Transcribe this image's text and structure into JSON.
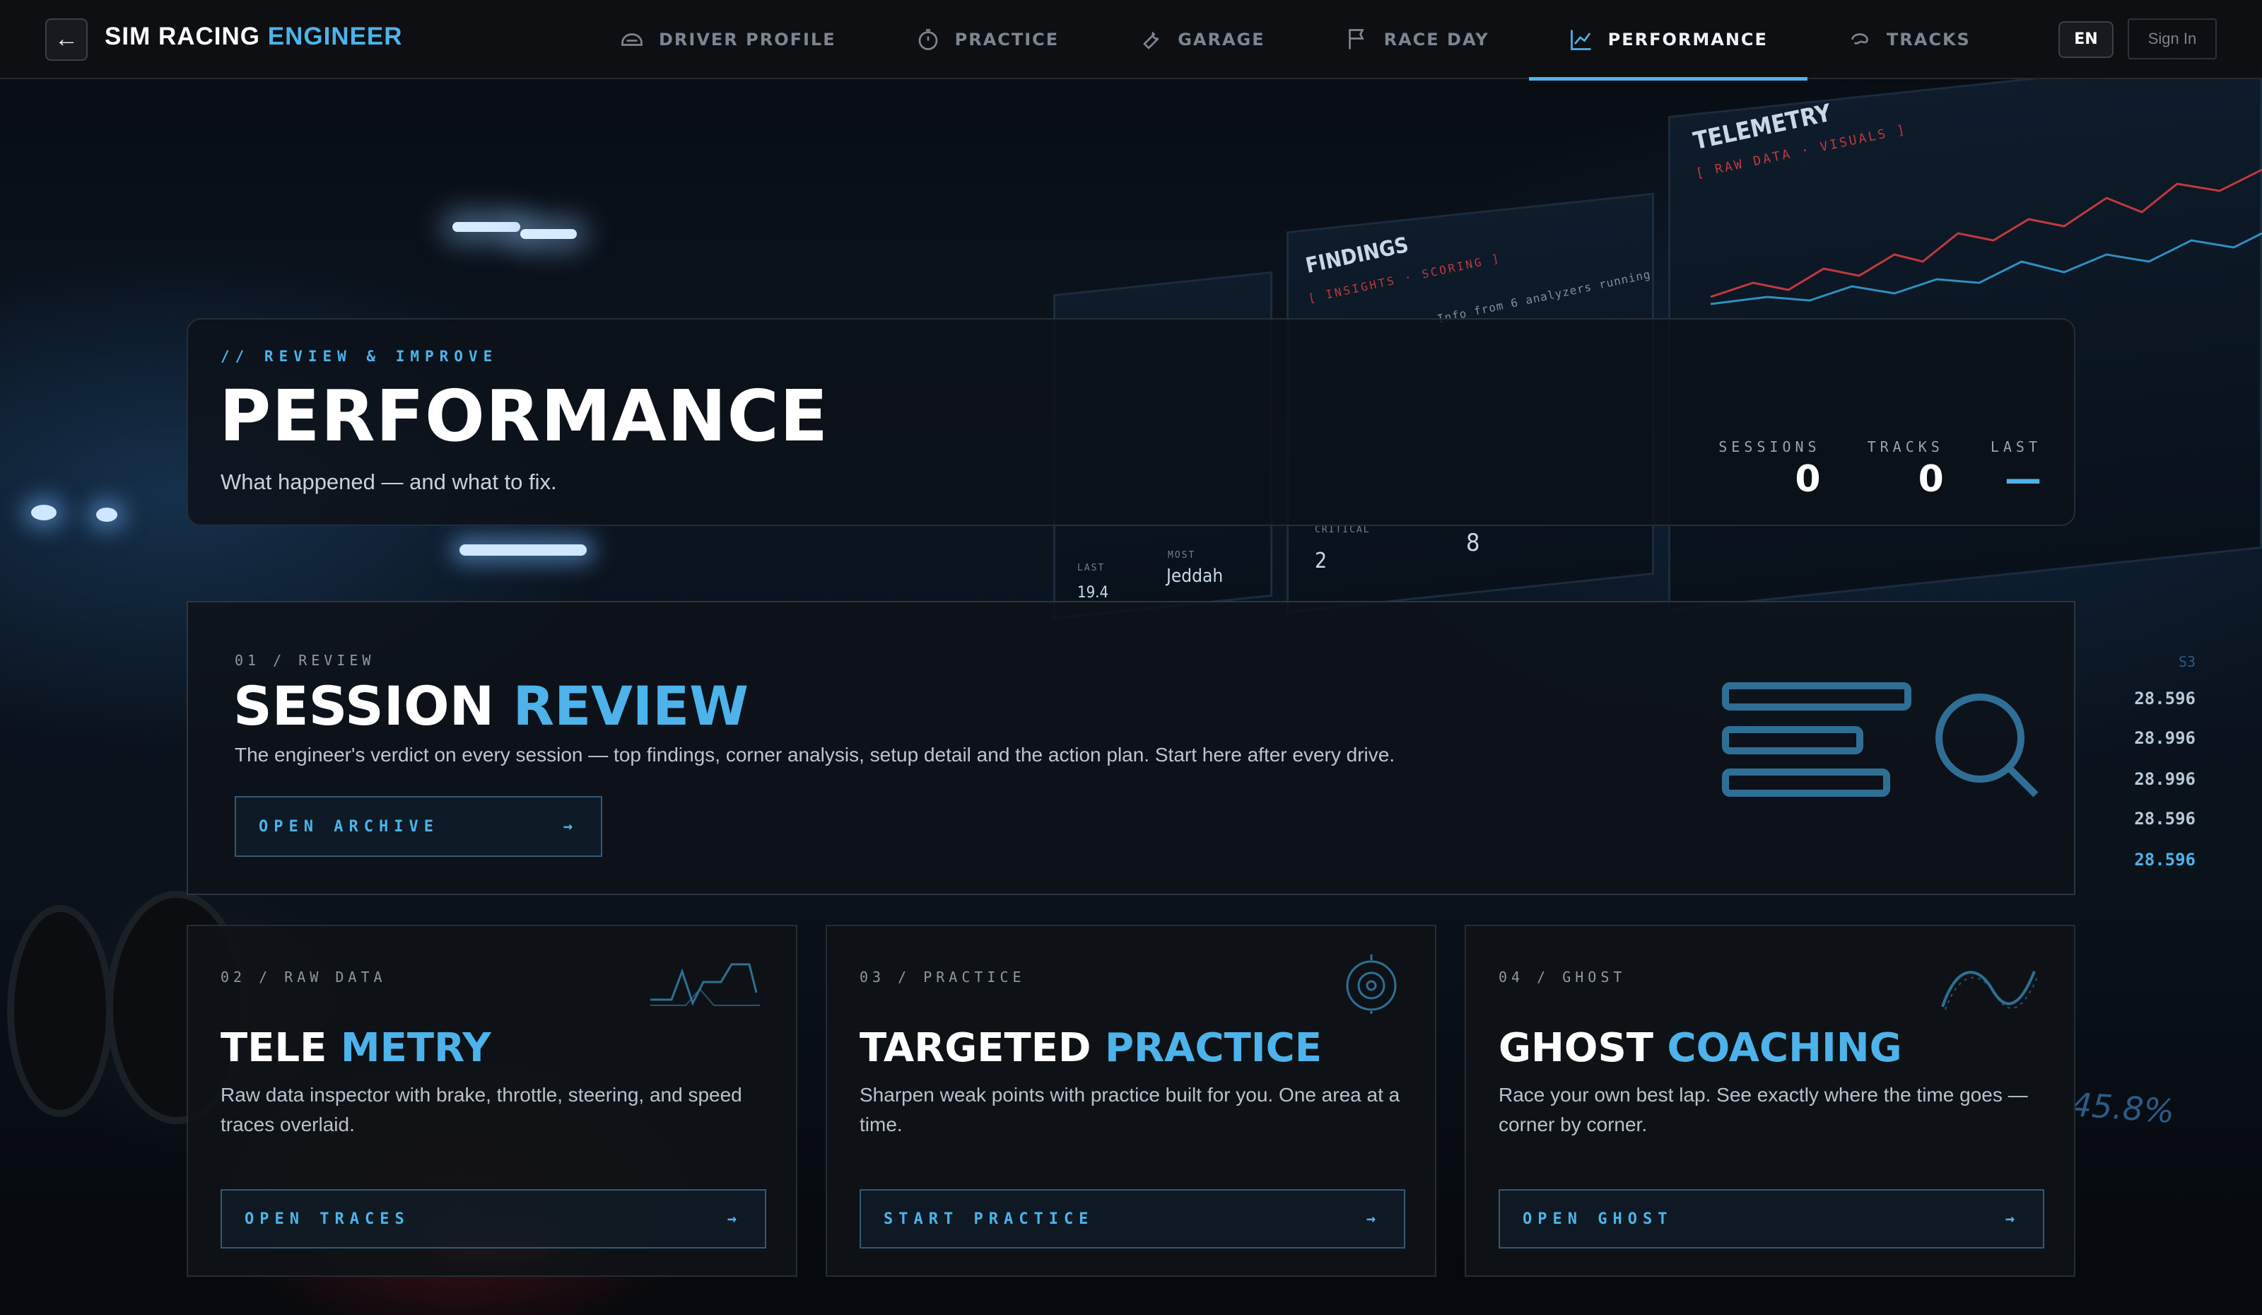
{
  "nav": {
    "back_icon": "arrow-left-icon",
    "brand_main": "SIM RACING",
    "brand_accent": "ENGINEER",
    "tabs": [
      {
        "label": "DRIVER PROFILE",
        "icon": "helmet-icon"
      },
      {
        "label": "PRACTICE",
        "icon": "stopwatch-icon"
      },
      {
        "label": "GARAGE",
        "icon": "wrench-icon"
      },
      {
        "label": "RACE DAY",
        "icon": "flag-icon"
      },
      {
        "label": "PERFORMANCE",
        "icon": "line-chart-icon",
        "active": true
      },
      {
        "label": "TRACKS",
        "icon": "track-icon"
      }
    ],
    "lang": "EN",
    "signin": "Sign In"
  },
  "hero": {
    "eyebrow": "// REVIEW & IMPROVE",
    "title": "PERFORMANCE",
    "subtitle": "What happened — and what to fix.",
    "stats": [
      {
        "label": "SESSIONS",
        "value": "0"
      },
      {
        "label": "TRACKS",
        "value": "0"
      },
      {
        "label": "LAST",
        "value": "—"
      }
    ]
  },
  "review": {
    "kicker": "01 / REVIEW",
    "title_main": "SESSION",
    "title_accent": "REVIEW",
    "desc": "The engineer's verdict on every session — top findings, corner analysis, setup detail and the action plan. Start here after every drive.",
    "button": "OPEN ARCHIVE",
    "arrow": "→"
  },
  "cards": [
    {
      "kicker": "02 / RAW DATA",
      "title_main": "TELE",
      "title_accent": "METRY",
      "desc": "Raw data inspector with brake, throttle, steering, and speed traces overlaid.",
      "button": "OPEN TRACES",
      "arrow": "→",
      "icon": "pulse-trace-icon"
    },
    {
      "kicker": "03 / PRACTICE",
      "title_main": "TARGETED",
      "title_accent": "PRACTICE",
      "desc": "Sharpen weak points with practice built for you. One area at a time.",
      "button": "START PRACTICE",
      "arrow": "→",
      "icon": "target-icon"
    },
    {
      "kicker": "04 / GHOST",
      "title_main": "GHOST",
      "title_accent": "COACHING",
      "desc": "Race your own best lap. See exactly where the time goes — corner by corner.",
      "button": "OPEN GHOST",
      "arrow": "→",
      "icon": "wave-icon"
    }
  ],
  "background": {
    "monitor_titles": [
      "TELEMETRY",
      "FINDINGS"
    ],
    "monitor_subs": [
      "[ RAW DATA · VISUALS ]",
      "[ INSIGHTS · SCORING ]"
    ],
    "monitor_text": "Info from 6 analyzers running",
    "monitor_values": [
      "Jeddah",
      "2",
      "8",
      "19.4"
    ],
    "monitor_labels": [
      "MOST",
      "CRITICAL",
      "LAST"
    ],
    "sector_label": "S3",
    "timings": [
      "28.596",
      "28.996",
      "28.996",
      "28.596",
      "28.596"
    ],
    "percent": "45.8%"
  },
  "colors": {
    "accent": "#4db3ea",
    "bg": "#05080c",
    "panel": "#0e1318"
  }
}
